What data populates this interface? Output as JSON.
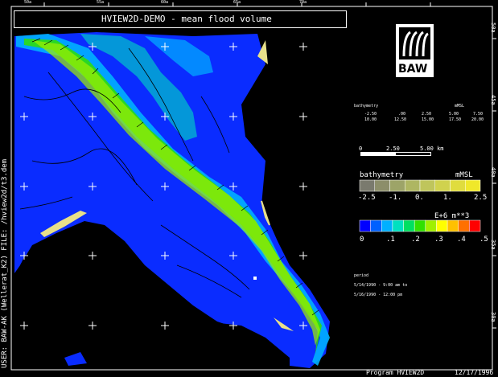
{
  "title": "HVIEW2D-DEMO - mean flood volume",
  "top_ticks": [
    "50a",
    "55a",
    "60a",
    "65a",
    "70a"
  ],
  "right_ticks": [
    "50a",
    "45a",
    "40a",
    "35a",
    "30a"
  ],
  "left_vertical_text": "USER: BAW-AK (Wellerat_K2)   FILE: /hview2d/t3.dem",
  "logo_text": "BAW",
  "bathy_table": {
    "header_left": "bathymetry",
    "header_right": "mMSL",
    "row1": [
      "-2.50",
      ".00",
      "2.50",
      "5.00",
      "7.50"
    ],
    "row2": [
      "10.00",
      "12.50",
      "15.00",
      "17.50",
      "20.00"
    ]
  },
  "scale_bar": {
    "labels": [
      "0",
      "2.50",
      "5.00 km"
    ]
  },
  "bathy_legend": {
    "title": "bathymetry",
    "unit": "mMSL",
    "labels": [
      "-2.5",
      "-1.",
      "0.",
      "1.",
      "2.5"
    ],
    "colors": [
      "#7a7a6e",
      "#8c8e6a",
      "#9da468",
      "#aeb662",
      "#bfc55c",
      "#d0d24e",
      "#e0dc3e",
      "#f0e82a"
    ]
  },
  "volume_legend": {
    "unit": "E+6 m**3",
    "labels": [
      "0",
      ".1",
      ".2",
      ".3",
      ".4",
      ".5"
    ],
    "colors": [
      "#0000ff",
      "#0060ff",
      "#00b0ff",
      "#00e0c0",
      "#00e060",
      "#30e000",
      "#a0f000",
      "#ffff00",
      "#ffc000",
      "#ff7000",
      "#ff0000"
    ]
  },
  "period": {
    "label": "period",
    "line1": "5/14/1990 - 9:00 am to",
    "line2": "5/16/1990 - 12:00 pm"
  },
  "footer": {
    "program": "Program  HVIEW2D",
    "date": "12/17/1996"
  },
  "colors": {
    "water": "#0a2cff",
    "land": "#000000",
    "shore": "#e8e08a"
  }
}
